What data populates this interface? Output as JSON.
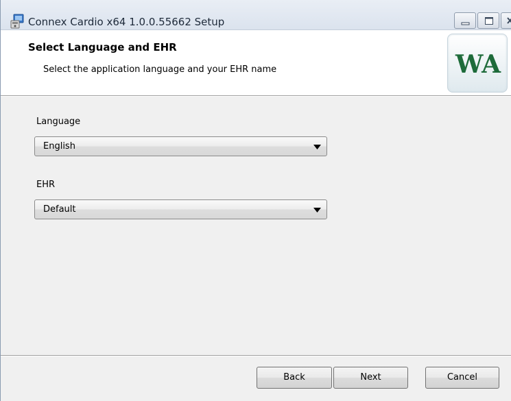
{
  "window": {
    "title": "Connex Cardio x64 1.0.0.55662 Setup"
  },
  "banner": {
    "title": "Select Language and EHR",
    "subtitle": "Select the application language and your EHR name",
    "logo_text": "WA",
    "logo_color": "#1e6b3a"
  },
  "form": {
    "language": {
      "label": "Language",
      "value": "English"
    },
    "ehr": {
      "label": "EHR",
      "value": "Default"
    }
  },
  "buttons": {
    "back": "Back",
    "next": "Next",
    "cancel": "Cancel"
  },
  "icons": {
    "title_icon": "installer-icon",
    "minimize": "minimize-icon",
    "maximize": "maximize-icon",
    "close": "close-icon",
    "dropdown": "chevron-down-icon"
  }
}
